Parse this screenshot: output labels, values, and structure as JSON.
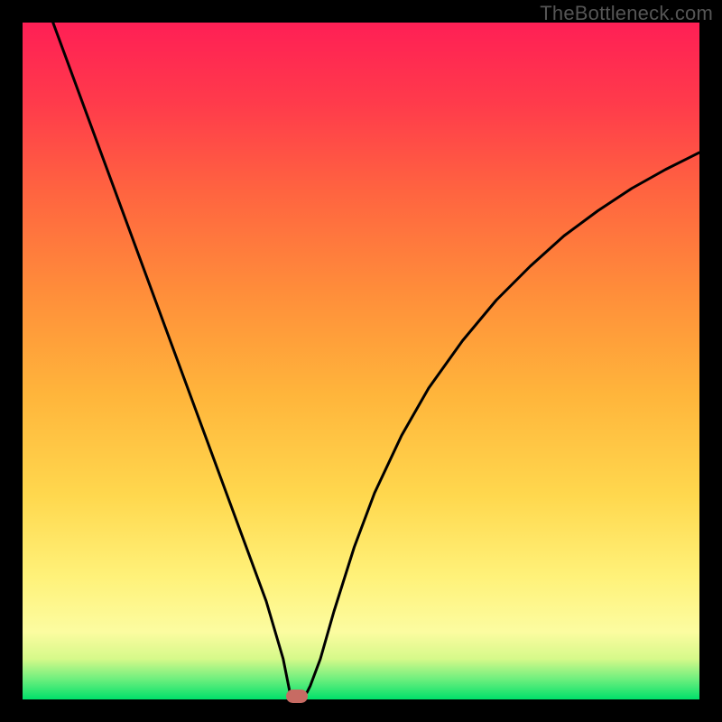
{
  "watermark": "TheBottleneck.com",
  "marker": {
    "cx": 0.405,
    "cy": 0.0,
    "color": "#c76b63"
  },
  "chart_data": {
    "type": "line",
    "title": "",
    "xlabel": "",
    "ylabel": "",
    "xlim": [
      0,
      1
    ],
    "ylim": [
      0,
      1
    ],
    "gradient_stops": [
      {
        "offset": 0.0,
        "color": "#00e06a"
      },
      {
        "offset": 0.03,
        "color": "#6eef7e"
      },
      {
        "offset": 0.06,
        "color": "#d6f98a"
      },
      {
        "offset": 0.1,
        "color": "#fcfca0"
      },
      {
        "offset": 0.18,
        "color": "#fff27a"
      },
      {
        "offset": 0.3,
        "color": "#ffd84e"
      },
      {
        "offset": 0.45,
        "color": "#ffb53b"
      },
      {
        "offset": 0.6,
        "color": "#ff8e3a"
      },
      {
        "offset": 0.75,
        "color": "#ff6440"
      },
      {
        "offset": 0.88,
        "color": "#ff3b4b"
      },
      {
        "offset": 1.0,
        "color": "#ff1f55"
      }
    ],
    "series": [
      {
        "name": "curve",
        "stroke": "#000000",
        "stroke_width": 3,
        "points": [
          {
            "x": 0.045,
            "y": 1.0
          },
          {
            "x": 0.08,
            "y": 0.905
          },
          {
            "x": 0.115,
            "y": 0.81
          },
          {
            "x": 0.15,
            "y": 0.715
          },
          {
            "x": 0.185,
            "y": 0.62
          },
          {
            "x": 0.22,
            "y": 0.525
          },
          {
            "x": 0.255,
            "y": 0.43
          },
          {
            "x": 0.29,
            "y": 0.335
          },
          {
            "x": 0.325,
            "y": 0.24
          },
          {
            "x": 0.36,
            "y": 0.145
          },
          {
            "x": 0.385,
            "y": 0.06
          },
          {
            "x": 0.393,
            "y": 0.02
          },
          {
            "x": 0.395,
            "y": 0.01
          },
          {
            "x": 0.42,
            "y": 0.01
          },
          {
            "x": 0.425,
            "y": 0.02
          },
          {
            "x": 0.44,
            "y": 0.06
          },
          {
            "x": 0.46,
            "y": 0.13
          },
          {
            "x": 0.49,
            "y": 0.225
          },
          {
            "x": 0.52,
            "y": 0.305
          },
          {
            "x": 0.56,
            "y": 0.39
          },
          {
            "x": 0.6,
            "y": 0.46
          },
          {
            "x": 0.65,
            "y": 0.53
          },
          {
            "x": 0.7,
            "y": 0.59
          },
          {
            "x": 0.75,
            "y": 0.64
          },
          {
            "x": 0.8,
            "y": 0.685
          },
          {
            "x": 0.85,
            "y": 0.722
          },
          {
            "x": 0.9,
            "y": 0.755
          },
          {
            "x": 0.95,
            "y": 0.783
          },
          {
            "x": 1.0,
            "y": 0.808
          }
        ]
      }
    ]
  }
}
